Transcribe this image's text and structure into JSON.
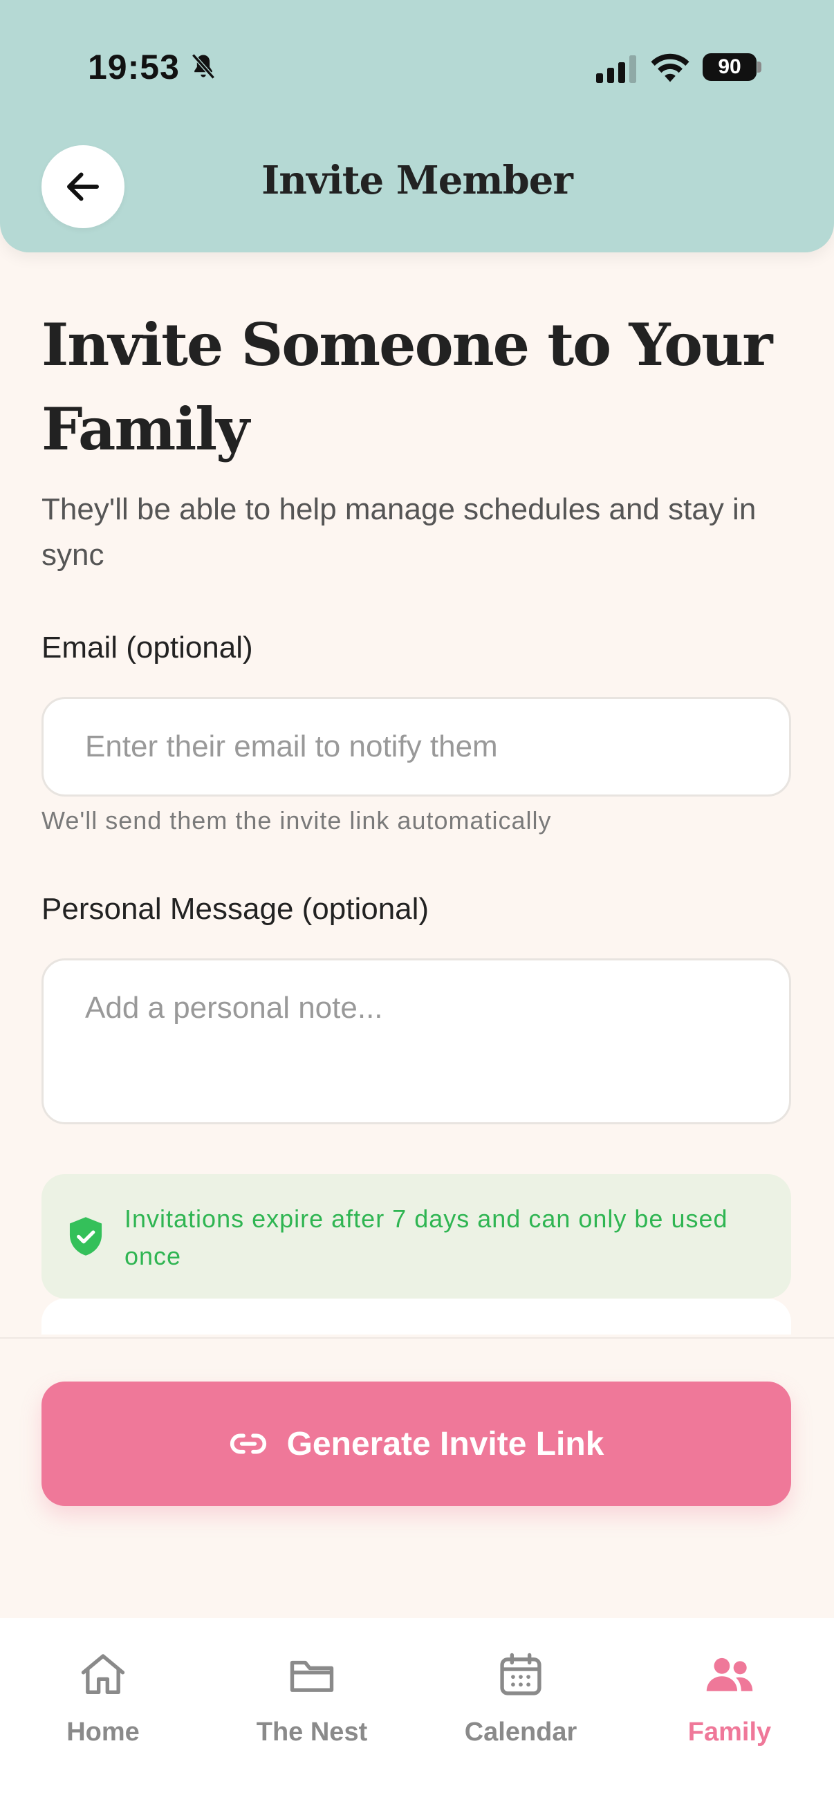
{
  "status_bar": {
    "time": "19:53",
    "battery": "90"
  },
  "header": {
    "title": "Invite Member"
  },
  "main": {
    "title": "Invite Someone to Your Family",
    "subtitle": "They'll be able to help manage schedules and stay in sync",
    "email": {
      "label": "Email (optional)",
      "placeholder": "Enter their email to notify them",
      "helper": "We'll send them the invite link automatically"
    },
    "message": {
      "label": "Personal Message (optional)",
      "placeholder": "Add a personal note..."
    },
    "notice": "Invitations expire after 7 days and can only be used once"
  },
  "action": {
    "generate_label": "Generate Invite Link"
  },
  "tab_bar": {
    "items": [
      {
        "label": "Home",
        "icon": "home-icon",
        "active": false
      },
      {
        "label": "The Nest",
        "icon": "folder-icon",
        "active": false
      },
      {
        "label": "Calendar",
        "icon": "calendar-icon",
        "active": false
      },
      {
        "label": "Family",
        "icon": "people-icon",
        "active": true
      }
    ]
  },
  "colors": {
    "header_bg": "#b5d9d4",
    "page_bg": "#fdf6f1",
    "accent_pink": "#ef7899",
    "notice_green": "#2fb552",
    "notice_bg": "#ecf2e4",
    "inactive_tab": "#8a8a8a"
  }
}
